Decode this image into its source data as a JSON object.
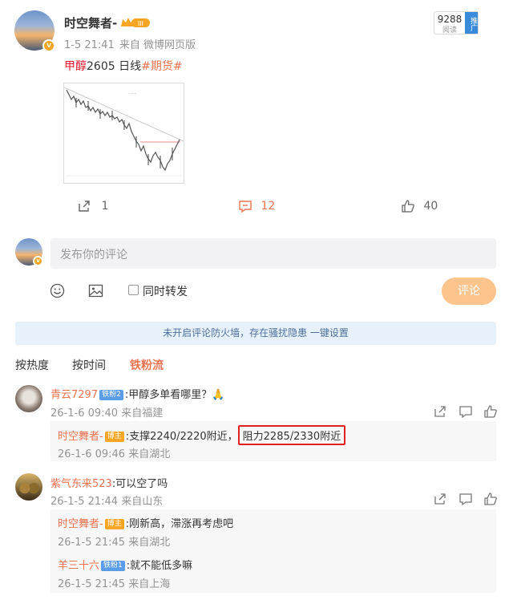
{
  "post": {
    "author": "时空舞者-",
    "vip_badge": "III",
    "time": "1-5 21:41",
    "source": "来自 微博网页版",
    "views": "9288",
    "views_label": "阅读",
    "promo_label": "推广",
    "text_red": "甲醇",
    "text_plain": "2605 日线",
    "text_tag": "#期货#",
    "actions": {
      "repost": "1",
      "comment": "12",
      "like": "40"
    }
  },
  "composer": {
    "placeholder": "发布你的评论",
    "repost_label": "同时转发",
    "submit_label": "评论"
  },
  "banner": "未开启评论防火墙，存在骚扰隐患 一键设置",
  "sort_tabs": [
    "按热度",
    "按时间",
    "铁粉流"
  ],
  "comments": [
    {
      "user": "青云7297",
      "badge": "铁粉2",
      "text": ":甲醇多单看哪里？🙏",
      "meta": "26-1-6 09:40 来自福建",
      "replies": [
        {
          "user": "时空舞者-",
          "badge": "博主",
          "text": ":支撑2240/2220附近，",
          "text_highlight": "阻力2285/2330附近",
          "meta": "26-1-6 09:46 来自湖北"
        }
      ]
    },
    {
      "user": "紫气东来523",
      "text": ":可以空了吗",
      "meta": "26-1-5 21:44 来自山东",
      "replies": [
        {
          "user": "时空舞者-",
          "badge": "博主",
          "text": ":刚新高，滞涨再考虑吧",
          "meta": "26-1-5 21:45 来自湖北"
        },
        {
          "user": "羊三十六",
          "badge": "铁粉1",
          "text": ":就不能低多嘛",
          "meta": "26-1-5 21:45 来自上海"
        }
      ]
    }
  ],
  "colors": {
    "accent": "#eb7350",
    "link": "#e6162d",
    "banner_bg": "#e7f1fc",
    "submit_bg": "#fdc48d"
  },
  "icons": [
    "vip-crown-icon",
    "verified-v-icon",
    "share-icon",
    "comment-icon",
    "like-icon",
    "emoji-icon",
    "image-icon",
    "reply-icon",
    "thumbs-up-icon"
  ]
}
